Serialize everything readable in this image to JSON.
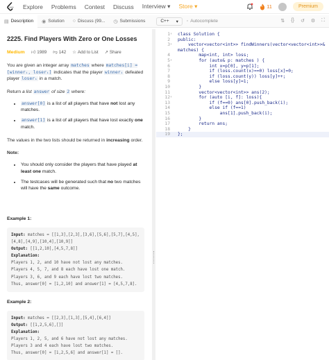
{
  "colors": {
    "store": "#f5a623",
    "medium": "#ffb800",
    "code_blue": "#1d2c8a",
    "premium_bg": "#fff3d6"
  },
  "nav": {
    "items": [
      "Explore",
      "Problems",
      "Contest",
      "Discuss",
      "Interview ▾",
      "Store ▾"
    ],
    "streak": "11",
    "premium": "Premium"
  },
  "tabs": {
    "description": "Description",
    "solution": "Solution",
    "discuss": "Discuss (99...",
    "submissions": "Submissions",
    "lang": "C++",
    "lang_arrow": "▾",
    "autocomplete": "Autocomplete"
  },
  "problem": {
    "title": "2225. Find Players With Zero or One Losses",
    "difficulty": "Medium",
    "likes": "1989",
    "dislikes": "142",
    "add_to_list": "Add to List",
    "share": "Share",
    "p1_a": "You are given an integer array",
    "p1_code1": "matches",
    "p1_b": "where",
    "p1_code2": "matches[i] = [winnerᵢ, loserᵢ]",
    "p1_c": "indicates that the player",
    "p1_code3": "winnerᵢ",
    "p1_d": "defeated player",
    "p1_code4": "loserᵢ",
    "p1_e": "in a match.",
    "p2_a": "Return",
    "p2_b": "a list",
    "p2_code": "answer",
    "p2_c": "of size",
    "p2_code2": "2",
    "p2_d": "where:",
    "li1_code": "answer[0]",
    "li1_a": "is a list of all players that have",
    "li1_b": "not",
    "li1_c": "lost any matches.",
    "li2_code": "answer[1]",
    "li2_a": "is a list of all players that have lost exactly",
    "li2_b": "one",
    "li2_c": "match.",
    "p3_a": "The values in the two lists should be returned in",
    "p3_b": "increasing",
    "p3_c": "order.",
    "note": "Note:",
    "n1_a": "You should only consider the players that have played",
    "n1_b": "at least one",
    "n1_c": "match.",
    "n2_a": "The testcases will be generated such that",
    "n2_b": "no",
    "n2_c": "two matches will have the",
    "n2_d": "same",
    "n2_e": "outcome.",
    "ex1": {
      "title": "Example 1:",
      "input_label": "Input:",
      "input": "matches = [[1,3],[2,3],[3,6],[5,6],[5,7],[4,5],[4,8],[4,9],[10,4],[10,9]]",
      "output_label": "Output:",
      "output": "[[1,2,10],[4,5,7,8]]",
      "expl_label": "Explanation:",
      "expl": [
        "Players 1, 2, and 10 have not lost any matches.",
        "Players 4, 5, 7, and 8 each have lost one match.",
        "Players 3, 6, and 9 each have lost two matches.",
        "Thus, answer[0] = [1,2,10] and answer[1] = [4,5,7,8]."
      ]
    },
    "ex2": {
      "title": "Example 2:",
      "input_label": "Input:",
      "input": "matches = [[2,3],[1,3],[5,4],[6,4]]",
      "output_label": "Output:",
      "output": "[[1,2,5,6],[]]",
      "expl_label": "Explanation:",
      "expl": [
        "Players 1, 2, 5, and 6 have not lost any matches.",
        "Players 3 and 4 each have lost two matches.",
        "Thus, answer[0] = [1,2,5,6] and answer[1] = []."
      ]
    }
  },
  "editor": {
    "lines": [
      {
        "n": "1",
        "fold": true,
        "text": "class Solution {"
      },
      {
        "n": "2",
        "fold": false,
        "text": "public:"
      },
      {
        "n": "3",
        "fold": true,
        "text": "    vector<vector<int>> findWinners(vector<vector<int>>&"
      },
      {
        "n": "",
        "fold": false,
        "text": "matches) {"
      },
      {
        "n": "4",
        "fold": false,
        "text": "        map<int, int> loss;"
      },
      {
        "n": "5",
        "fold": true,
        "text": "        for (auto& p: matches ) {"
      },
      {
        "n": "6",
        "fold": false,
        "text": "            int x=p[0], y=p[1];"
      },
      {
        "n": "7",
        "fold": false,
        "text": "            if (loss.count(x)==0) loss[x]=0;"
      },
      {
        "n": "8",
        "fold": false,
        "text": "            if (loss.count(y)) loss[y]++;"
      },
      {
        "n": "9",
        "fold": false,
        "text": "            else loss[y]=1;"
      },
      {
        "n": "10",
        "fold": false,
        "text": "        }"
      },
      {
        "n": "11",
        "fold": false,
        "text": "        vector<vector<int>> ans(2);"
      },
      {
        "n": "12",
        "fold": true,
        "text": "        for (auto [i, f]: loss){"
      },
      {
        "n": "13",
        "fold": false,
        "text": "            if (f==0) ans[0].push_back(i);"
      },
      {
        "n": "14",
        "fold": false,
        "text": "            else if (f==1)"
      },
      {
        "n": "15",
        "fold": false,
        "text": "                ans[1].push_back(i);"
      },
      {
        "n": "16",
        "fold": false,
        "text": "        }"
      },
      {
        "n": "17",
        "fold": false,
        "text": "        return ans;"
      },
      {
        "n": "18",
        "fold": false,
        "text": "    }"
      },
      {
        "n": "19",
        "fold": false,
        "text": "};"
      }
    ]
  }
}
